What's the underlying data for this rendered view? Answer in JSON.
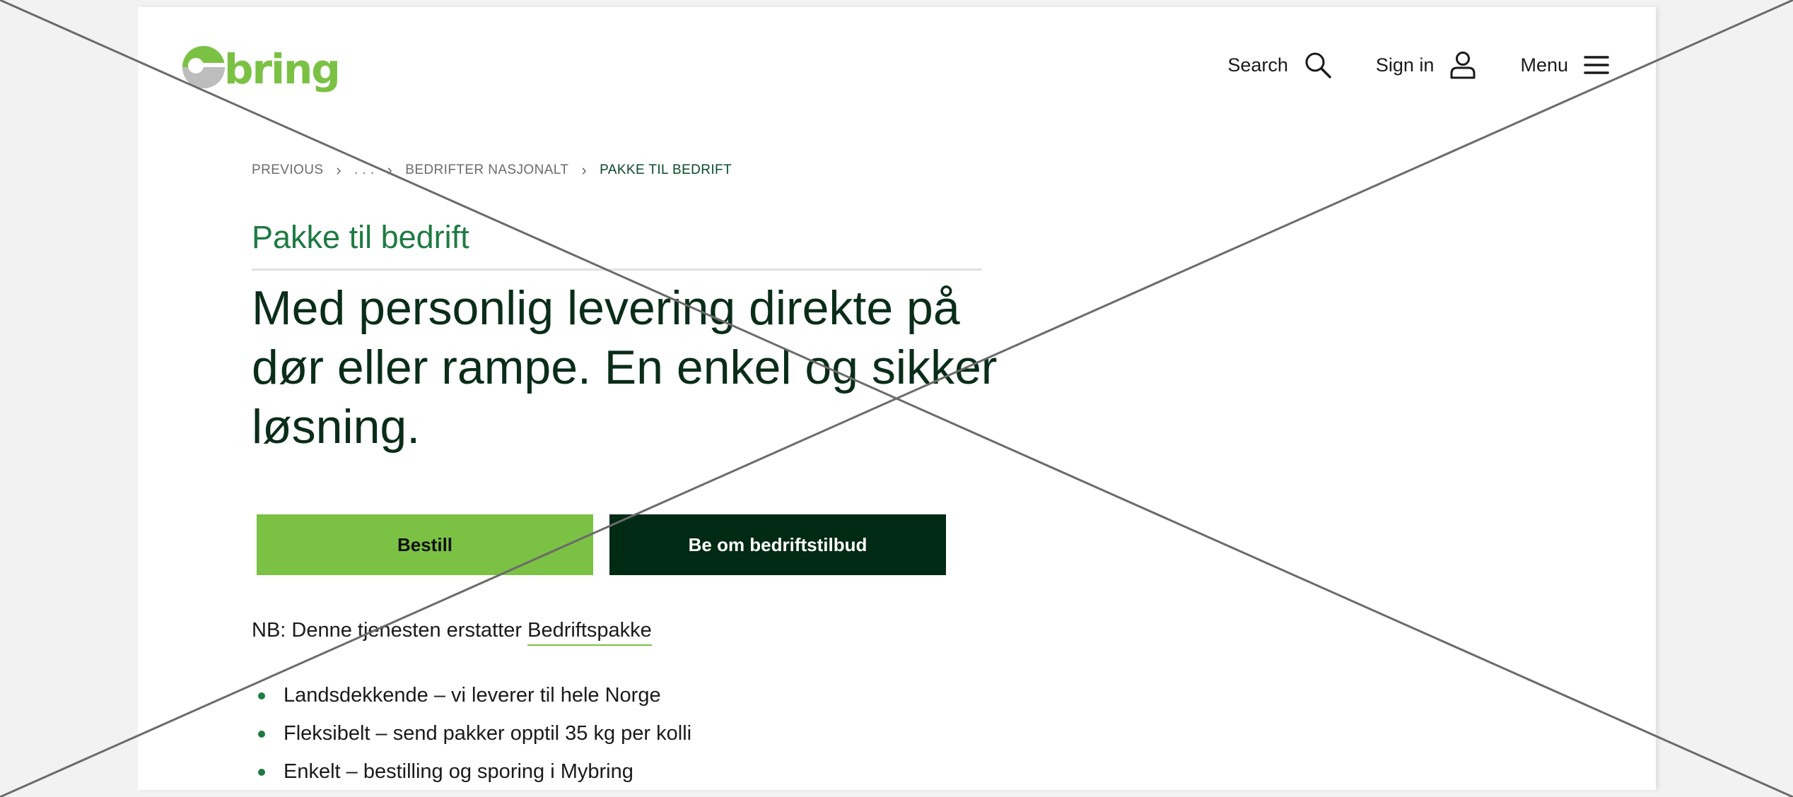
{
  "colors": {
    "brand_green": "#7bc144",
    "dark_green": "#002a14",
    "heading_green": "#1e7b43",
    "text_dark_green": "#0a2d1a"
  },
  "header": {
    "logo_text": "bring",
    "search_label": "Search",
    "search_icon": "search-icon",
    "signin_label": "Sign in",
    "signin_icon": "user-icon",
    "menu_label": "Menu",
    "menu_icon": "hamburger-icon"
  },
  "breadcrumb": {
    "items": [
      "PREVIOUS",
      ". . .",
      "BEDRIFTER NASJONALT",
      "PAKKE TIL BEDRIFT"
    ]
  },
  "main": {
    "kicker": "Pakke til bedrift",
    "headline": "Med personlig levering direkte på dør eller rampe. En enkel og sikker løsning.",
    "primary_button": "Bestill",
    "secondary_button": "Be om bedriftstilbud",
    "note_text": "NB: Denne tjenesten erstatter",
    "note_link": "Bedriftspakke",
    "bullets": [
      "Landsdekkende – vi leverer til hele Norge",
      "Fleksibelt – send pakker opptil 35 kg per kolli",
      "Enkelt – bestilling og sporing i Mybring"
    ]
  }
}
